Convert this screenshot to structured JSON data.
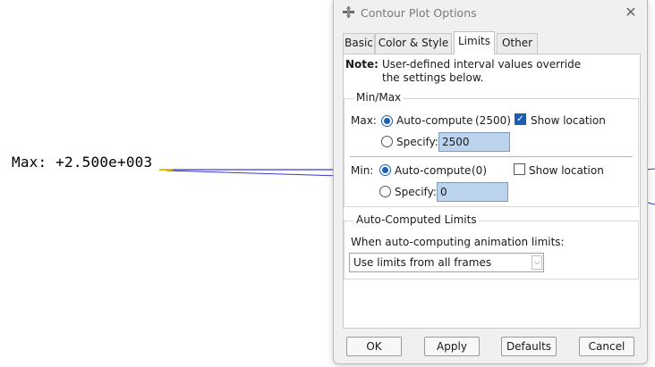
{
  "viewport": {
    "max_label": "Max: +2.500e+003"
  },
  "dialog": {
    "title": "Contour Plot Options",
    "tabs": [
      {
        "label": "Basic",
        "active": false
      },
      {
        "label": "Color & Style",
        "active": false
      },
      {
        "label": "Limits",
        "active": true
      },
      {
        "label": "Other",
        "active": false
      }
    ],
    "note": {
      "prefix": "Note:",
      "line1": "User-defined interval values override",
      "line2": "the settings below."
    },
    "minmax": {
      "group_title": "Min/Max",
      "max": {
        "label": "Max:",
        "auto_label": "Auto-compute",
        "auto_value": "(2500)",
        "auto_selected": true,
        "show_location_label": "Show location",
        "show_location_checked": true,
        "specify_label": "Specify:",
        "specify_value": "2500"
      },
      "min": {
        "label": "Min:",
        "auto_label": "Auto-compute",
        "auto_value": "(0)",
        "auto_selected": true,
        "show_location_label": "Show location",
        "show_location_checked": false,
        "specify_label": "Specify:",
        "specify_value": "0"
      }
    },
    "auto_limits": {
      "group_title": "Auto-Computed Limits",
      "prompt": "When auto-computing animation limits:",
      "selected_option": "Use limits from all frames"
    },
    "buttons": {
      "ok": "OK",
      "apply": "Apply",
      "defaults": "Defaults",
      "cancel": "Cancel"
    }
  },
  "colors": {
    "accent": "#1a5fb4",
    "field_bg": "#bcd3ee",
    "plot_line": "#3a3ad0",
    "title_text": "#7a7a7a"
  }
}
